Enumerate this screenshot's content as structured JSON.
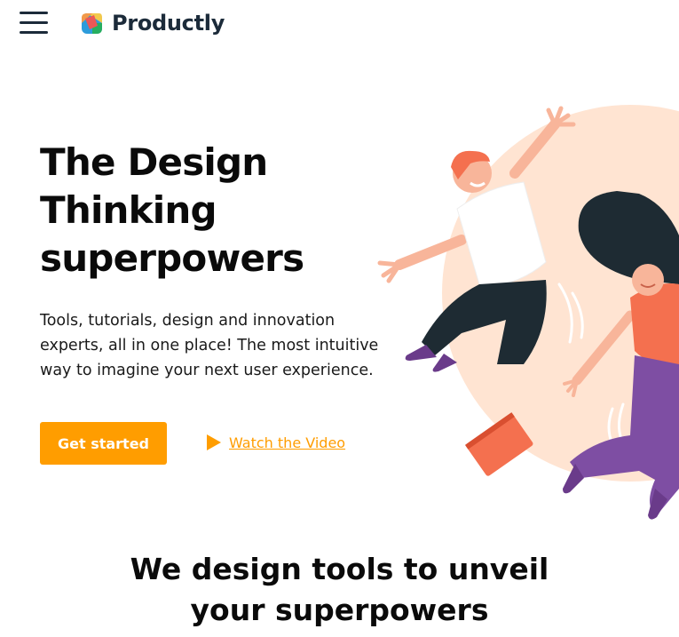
{
  "header": {
    "brand": "Productly",
    "menu_icon": "hamburger-menu-icon",
    "logo_icon": "productly-logo-icon"
  },
  "hero": {
    "title_lines": [
      "The Design",
      "Thinking",
      "superpowers"
    ],
    "description_lines": [
      "Tools, tutorials, design and innovation",
      "experts, all in one place! The most intuitive",
      "way to imagine your next user experience."
    ],
    "cta_label": "Get started",
    "video_link_label": "Watch the Video",
    "video_icon": "play-icon"
  },
  "section": {
    "title_lines": [
      "We design tools to unveil",
      "your superpowers"
    ]
  },
  "colors": {
    "accent": "#ff9d00",
    "brand_text": "#1c2b3a",
    "peach": "#ffe4d2",
    "coral": "#f4704f",
    "purple": "#7e4ea3",
    "dark": "#1e2b33"
  }
}
